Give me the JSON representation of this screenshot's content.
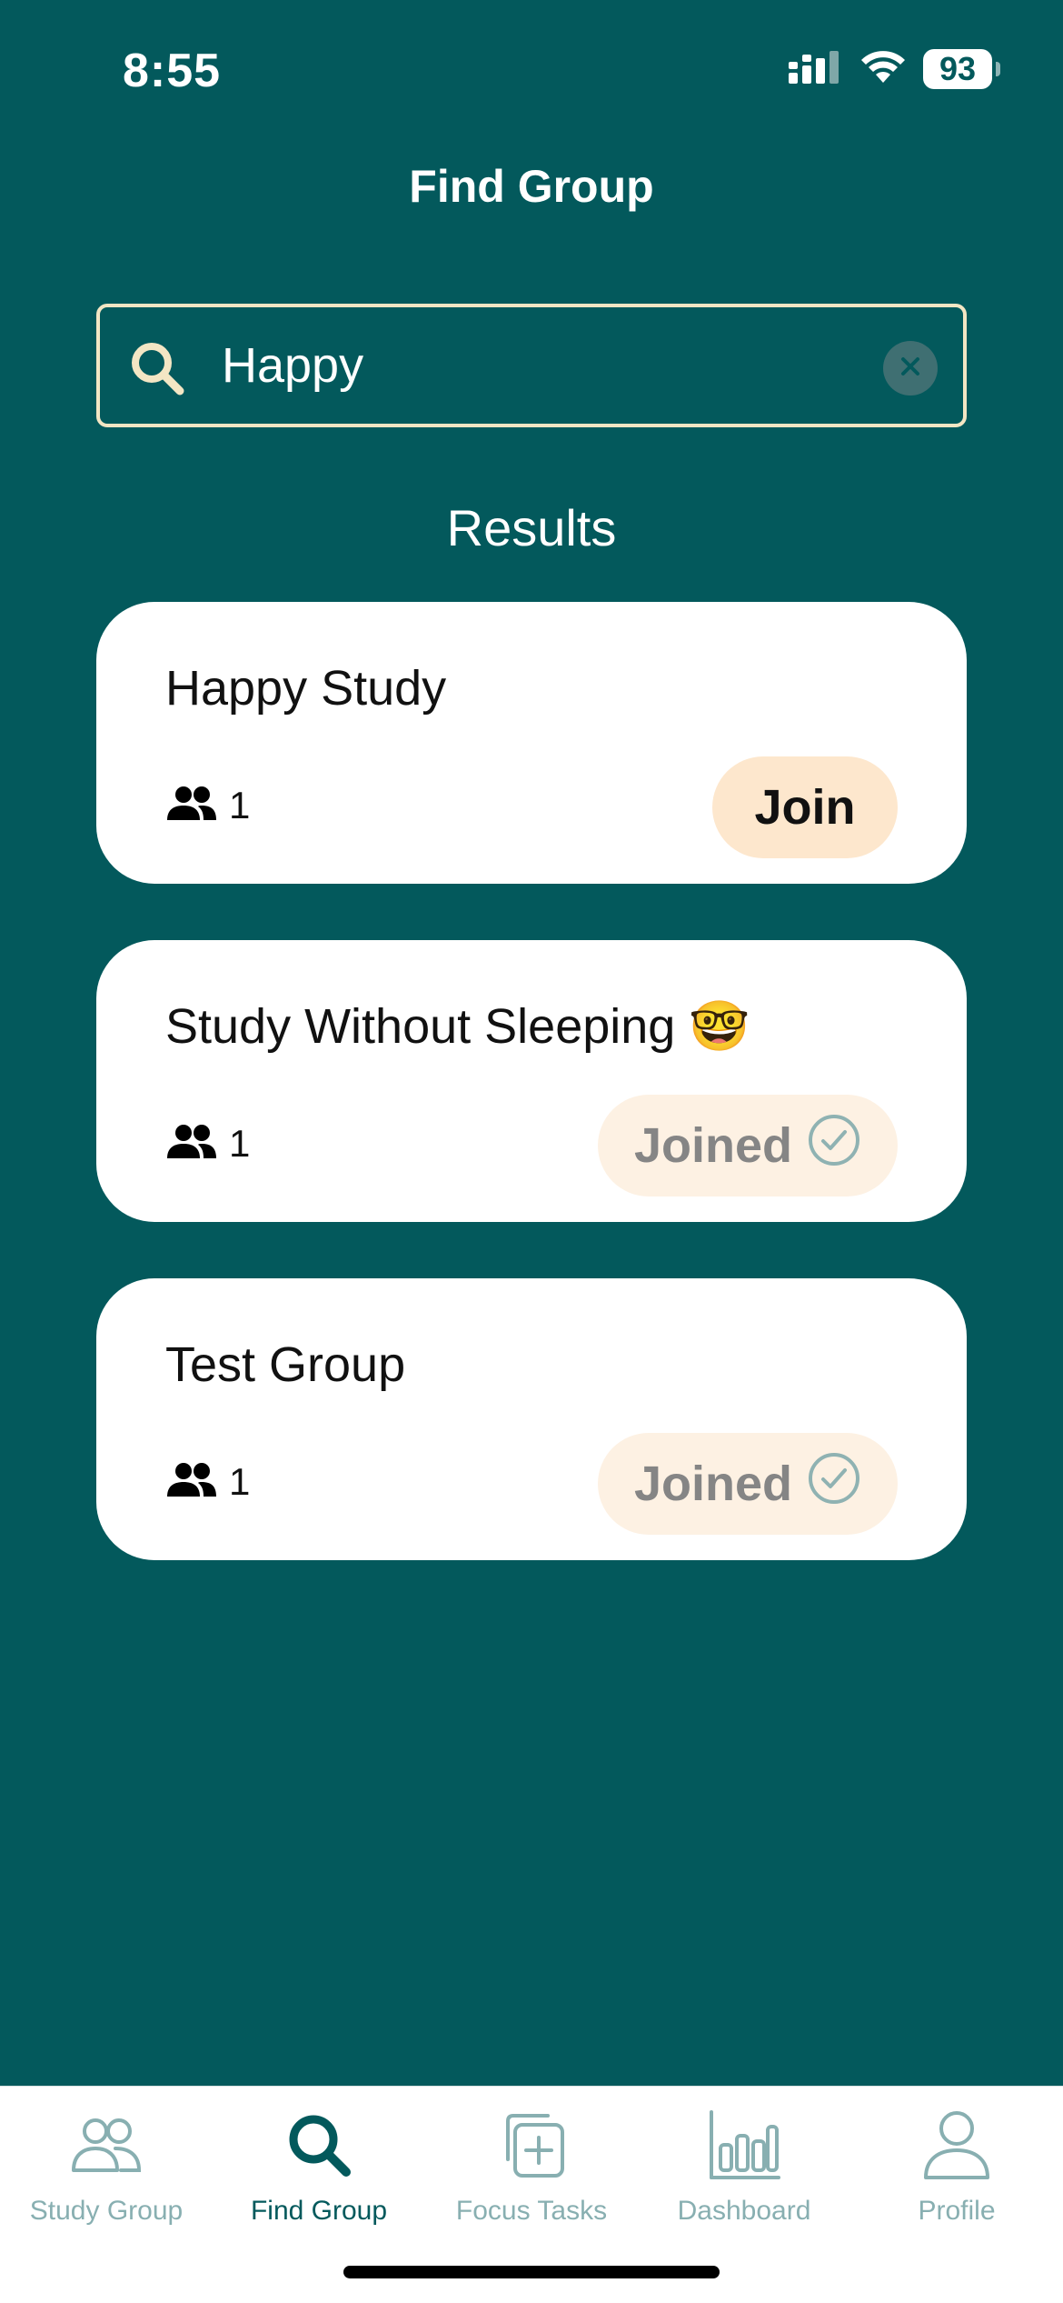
{
  "status_bar": {
    "time": "8:55",
    "battery": "93"
  },
  "header": {
    "title": "Find Group"
  },
  "search": {
    "value": "Happy"
  },
  "results": {
    "heading": "Results",
    "items": [
      {
        "title": "Happy Study",
        "members": "1",
        "action": "Join"
      },
      {
        "title": "Study Without Sleeping 🤓",
        "members": "1",
        "action": "Joined"
      },
      {
        "title": "Test Group",
        "members": "1",
        "action": "Joined"
      }
    ]
  },
  "tab_bar": {
    "items": [
      {
        "label": "Study Group",
        "icon": "people-icon"
      },
      {
        "label": "Find Group",
        "icon": "search-icon"
      },
      {
        "label": "Focus Tasks",
        "icon": "add-task-icon"
      },
      {
        "label": "Dashboard",
        "icon": "bar-chart-icon"
      },
      {
        "label": "Profile",
        "icon": "person-icon"
      }
    ],
    "active": "Find Group"
  },
  "colors": {
    "background": "#03595c",
    "search_border": "#f3e6c4",
    "join_button": "#fde7cd",
    "joined_button": "#fdf1e3",
    "tab_inactive": "#88afb1",
    "tab_active": "#03595c"
  }
}
